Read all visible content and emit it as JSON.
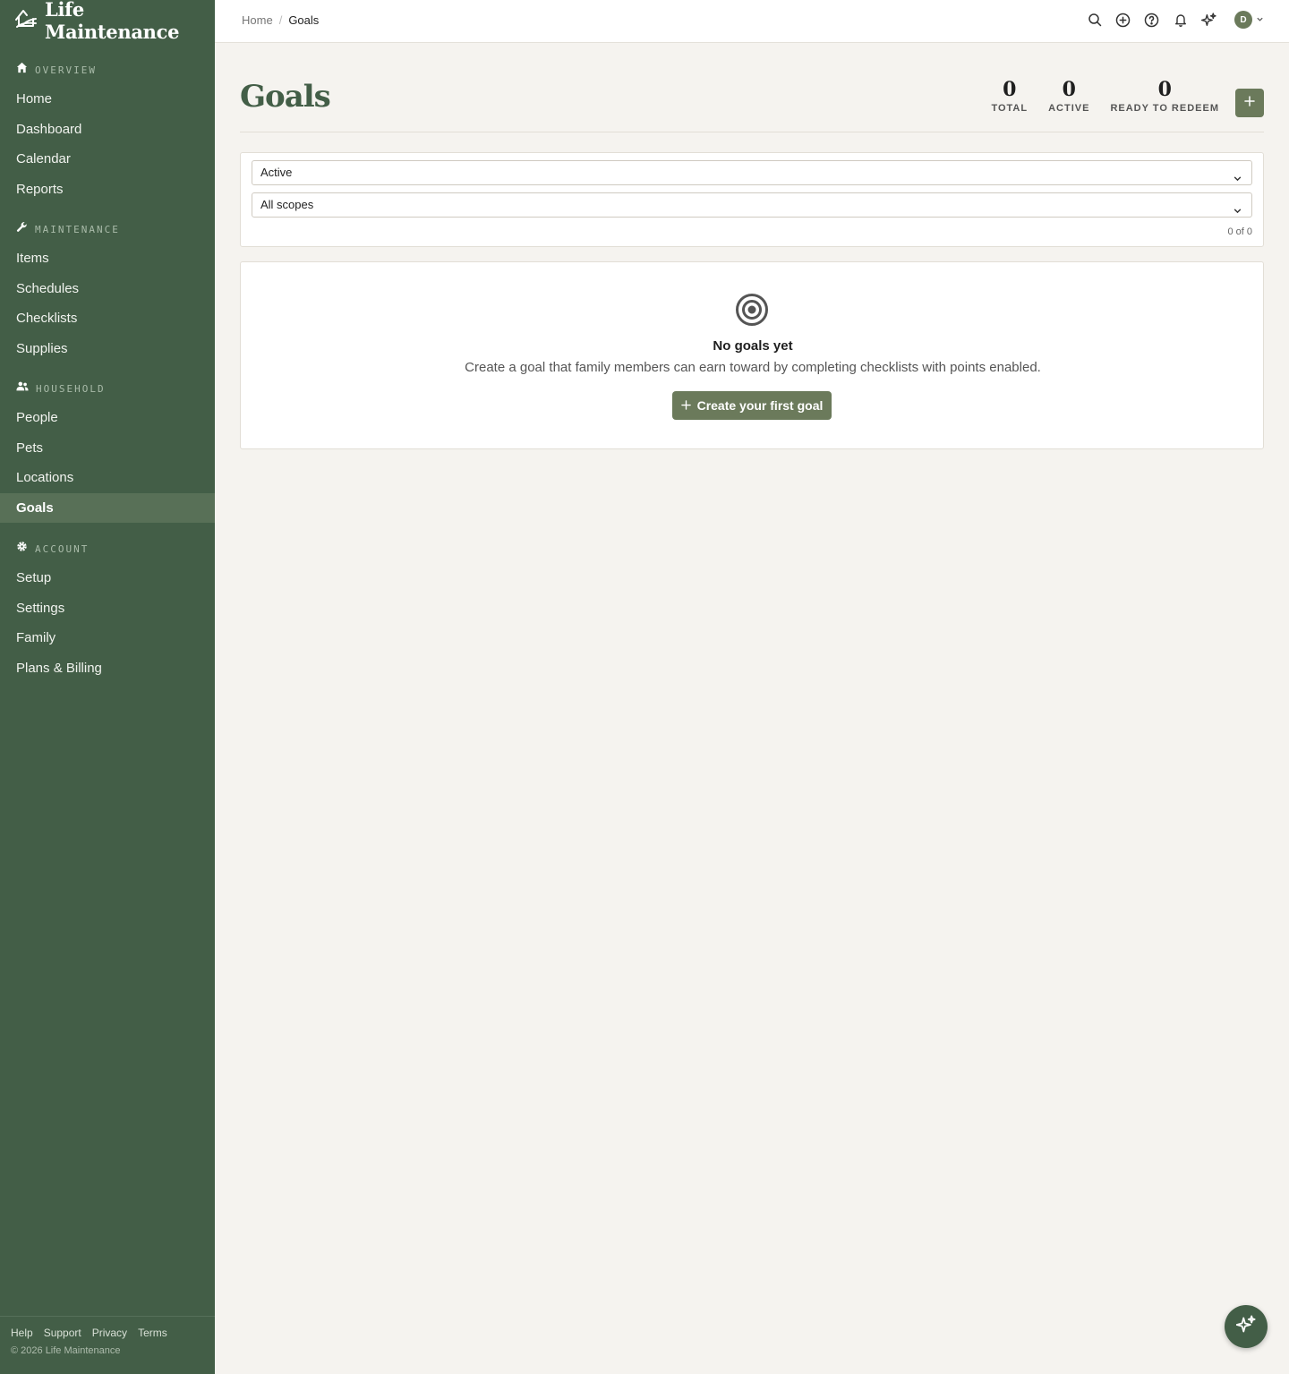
{
  "app": {
    "brand": "Life Maintenance"
  },
  "sidebar": {
    "sections": [
      {
        "label": "OVERVIEW",
        "icon": "home-icon",
        "items": [
          "Home",
          "Dashboard",
          "Calendar",
          "Reports"
        ]
      },
      {
        "label": "MAINTENANCE",
        "icon": "wrench-icon",
        "items": [
          "Items",
          "Schedules",
          "Checklists",
          "Supplies"
        ]
      },
      {
        "label": "HOUSEHOLD",
        "icon": "people-icon",
        "items": [
          "People",
          "Pets",
          "Locations",
          "Goals"
        ]
      },
      {
        "label": "ACCOUNT",
        "icon": "gear-icon",
        "items": [
          "Setup",
          "Settings",
          "Family",
          "Plans & Billing"
        ]
      }
    ],
    "active_item": "Goals",
    "footer_links": [
      "Help",
      "Support",
      "Privacy",
      "Terms"
    ],
    "copyright": "© 2026 Life Maintenance"
  },
  "topbar": {
    "breadcrumb": {
      "home": "Home",
      "separator": "/",
      "current": "Goals"
    },
    "icons": [
      "search-icon",
      "plus-circle-icon",
      "help-icon",
      "bell-icon",
      "sparkle-icon"
    ],
    "avatar_initial": "D"
  },
  "header": {
    "title": "Goals",
    "stats": [
      {
        "value": "0",
        "label": "TOTAL"
      },
      {
        "value": "0",
        "label": "ACTIVE"
      },
      {
        "value": "0",
        "label": "READY TO REDEEM"
      }
    ]
  },
  "filters": {
    "status_selected": "Active",
    "scope_selected": "All scopes",
    "count_text": "0 of 0"
  },
  "empty_state": {
    "icon": "target-icon",
    "title": "No goals yet",
    "description": "Create a goal that family members can earn toward by completing checklists with points enabled.",
    "button_label": "Create your first goal"
  },
  "colors": {
    "sidebar_bg": "#435e47",
    "accent": "#6b7a5b",
    "page_bg": "#f5f3ef"
  }
}
